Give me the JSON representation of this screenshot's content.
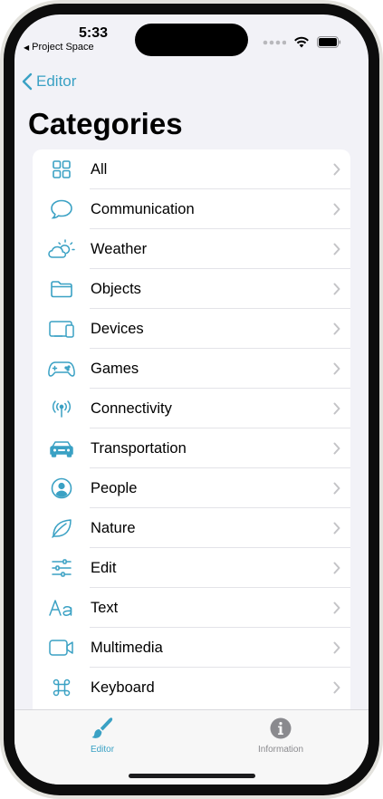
{
  "status_bar": {
    "time": "5:33",
    "back_app": "Project Space"
  },
  "nav": {
    "back_label": "Editor",
    "title": "Categories"
  },
  "categories": [
    {
      "label": "All",
      "icon": "grid-icon"
    },
    {
      "label": "Communication",
      "icon": "speech-bubble-icon"
    },
    {
      "label": "Weather",
      "icon": "cloud-sun-icon"
    },
    {
      "label": "Objects",
      "icon": "folder-icon"
    },
    {
      "label": "Devices",
      "icon": "devices-icon"
    },
    {
      "label": "Games",
      "icon": "gamecontroller-icon"
    },
    {
      "label": "Connectivity",
      "icon": "antenna-icon"
    },
    {
      "label": "Transportation",
      "icon": "car-icon"
    },
    {
      "label": "People",
      "icon": "person-circle-icon"
    },
    {
      "label": "Nature",
      "icon": "leaf-icon"
    },
    {
      "label": "Edit",
      "icon": "sliders-icon"
    },
    {
      "label": "Text",
      "icon": "text-format-icon"
    },
    {
      "label": "Multimedia",
      "icon": "video-icon"
    },
    {
      "label": "Keyboard",
      "icon": "command-icon"
    }
  ],
  "tab_bar": {
    "editor_label": "Editor",
    "information_label": "Information"
  },
  "colors": {
    "accent": "#3aa1c4",
    "inactive": "#8a8a8e",
    "background": "#f2f2f7"
  }
}
